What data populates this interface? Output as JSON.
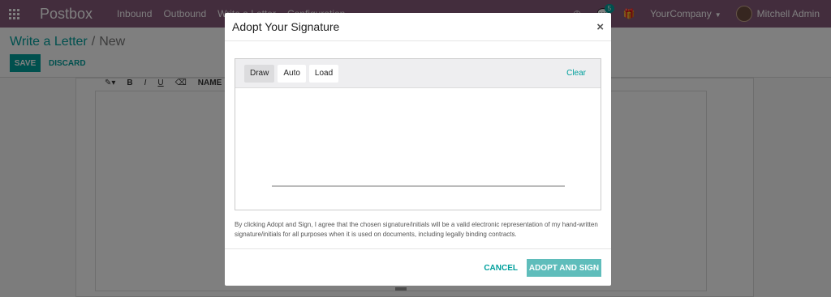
{
  "navbar": {
    "app_name": "Postbox",
    "menu": [
      "Inbound",
      "Outbound",
      "Write a Letter",
      "Configuration"
    ],
    "messages_count": "5",
    "company": "YourCompany",
    "user": "Mitchell Admin"
  },
  "breadcrumb": {
    "parent": "Write a Letter",
    "separator": "/",
    "current": "New"
  },
  "actions": {
    "save": "SAVE",
    "discard": "DISCARD"
  },
  "editor": {
    "toolbar": [
      "✎▾",
      "B",
      "I",
      "U",
      "⌫",
      "NAME"
    ]
  },
  "modal": {
    "title": "Adopt Your Signature",
    "close": "×",
    "tabs": [
      "Draw",
      "Auto",
      "Load"
    ],
    "active_tab": "Draw",
    "clear": "Clear",
    "legal": "By clicking Adopt and Sign, I agree that the chosen signature/initials will be a valid electronic representation of my hand-written signature/initials for all purposes when it is used on documents, including legally binding contracts.",
    "cancel": "CANCEL",
    "adopt": "ADOPT AND SIGN"
  },
  "colors": {
    "brand": "#875a7b",
    "accent": "#00a09d",
    "adopt_button": "#5fbdbb"
  }
}
